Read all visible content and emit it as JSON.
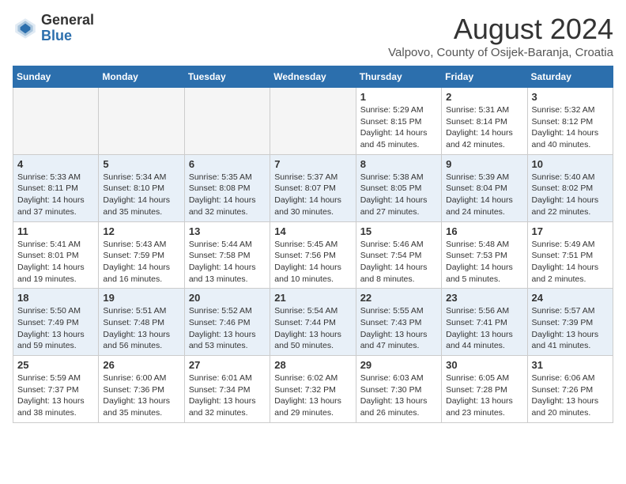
{
  "header": {
    "logo_line1": "General",
    "logo_line2": "Blue",
    "month_year": "August 2024",
    "location": "Valpovo, County of Osijek-Baranja, Croatia"
  },
  "weekdays": [
    "Sunday",
    "Monday",
    "Tuesday",
    "Wednesday",
    "Thursday",
    "Friday",
    "Saturday"
  ],
  "weeks": [
    [
      {
        "day": "",
        "info": ""
      },
      {
        "day": "",
        "info": ""
      },
      {
        "day": "",
        "info": ""
      },
      {
        "day": "",
        "info": ""
      },
      {
        "day": "1",
        "info": "Sunrise: 5:29 AM\nSunset: 8:15 PM\nDaylight: 14 hours\nand 45 minutes."
      },
      {
        "day": "2",
        "info": "Sunrise: 5:31 AM\nSunset: 8:14 PM\nDaylight: 14 hours\nand 42 minutes."
      },
      {
        "day": "3",
        "info": "Sunrise: 5:32 AM\nSunset: 8:12 PM\nDaylight: 14 hours\nand 40 minutes."
      }
    ],
    [
      {
        "day": "4",
        "info": "Sunrise: 5:33 AM\nSunset: 8:11 PM\nDaylight: 14 hours\nand 37 minutes."
      },
      {
        "day": "5",
        "info": "Sunrise: 5:34 AM\nSunset: 8:10 PM\nDaylight: 14 hours\nand 35 minutes."
      },
      {
        "day": "6",
        "info": "Sunrise: 5:35 AM\nSunset: 8:08 PM\nDaylight: 14 hours\nand 32 minutes."
      },
      {
        "day": "7",
        "info": "Sunrise: 5:37 AM\nSunset: 8:07 PM\nDaylight: 14 hours\nand 30 minutes."
      },
      {
        "day": "8",
        "info": "Sunrise: 5:38 AM\nSunset: 8:05 PM\nDaylight: 14 hours\nand 27 minutes."
      },
      {
        "day": "9",
        "info": "Sunrise: 5:39 AM\nSunset: 8:04 PM\nDaylight: 14 hours\nand 24 minutes."
      },
      {
        "day": "10",
        "info": "Sunrise: 5:40 AM\nSunset: 8:02 PM\nDaylight: 14 hours\nand 22 minutes."
      }
    ],
    [
      {
        "day": "11",
        "info": "Sunrise: 5:41 AM\nSunset: 8:01 PM\nDaylight: 14 hours\nand 19 minutes."
      },
      {
        "day": "12",
        "info": "Sunrise: 5:43 AM\nSunset: 7:59 PM\nDaylight: 14 hours\nand 16 minutes."
      },
      {
        "day": "13",
        "info": "Sunrise: 5:44 AM\nSunset: 7:58 PM\nDaylight: 14 hours\nand 13 minutes."
      },
      {
        "day": "14",
        "info": "Sunrise: 5:45 AM\nSunset: 7:56 PM\nDaylight: 14 hours\nand 10 minutes."
      },
      {
        "day": "15",
        "info": "Sunrise: 5:46 AM\nSunset: 7:54 PM\nDaylight: 14 hours\nand 8 minutes."
      },
      {
        "day": "16",
        "info": "Sunrise: 5:48 AM\nSunset: 7:53 PM\nDaylight: 14 hours\nand 5 minutes."
      },
      {
        "day": "17",
        "info": "Sunrise: 5:49 AM\nSunset: 7:51 PM\nDaylight: 14 hours\nand 2 minutes."
      }
    ],
    [
      {
        "day": "18",
        "info": "Sunrise: 5:50 AM\nSunset: 7:49 PM\nDaylight: 13 hours\nand 59 minutes."
      },
      {
        "day": "19",
        "info": "Sunrise: 5:51 AM\nSunset: 7:48 PM\nDaylight: 13 hours\nand 56 minutes."
      },
      {
        "day": "20",
        "info": "Sunrise: 5:52 AM\nSunset: 7:46 PM\nDaylight: 13 hours\nand 53 minutes."
      },
      {
        "day": "21",
        "info": "Sunrise: 5:54 AM\nSunset: 7:44 PM\nDaylight: 13 hours\nand 50 minutes."
      },
      {
        "day": "22",
        "info": "Sunrise: 5:55 AM\nSunset: 7:43 PM\nDaylight: 13 hours\nand 47 minutes."
      },
      {
        "day": "23",
        "info": "Sunrise: 5:56 AM\nSunset: 7:41 PM\nDaylight: 13 hours\nand 44 minutes."
      },
      {
        "day": "24",
        "info": "Sunrise: 5:57 AM\nSunset: 7:39 PM\nDaylight: 13 hours\nand 41 minutes."
      }
    ],
    [
      {
        "day": "25",
        "info": "Sunrise: 5:59 AM\nSunset: 7:37 PM\nDaylight: 13 hours\nand 38 minutes."
      },
      {
        "day": "26",
        "info": "Sunrise: 6:00 AM\nSunset: 7:36 PM\nDaylight: 13 hours\nand 35 minutes."
      },
      {
        "day": "27",
        "info": "Sunrise: 6:01 AM\nSunset: 7:34 PM\nDaylight: 13 hours\nand 32 minutes."
      },
      {
        "day": "28",
        "info": "Sunrise: 6:02 AM\nSunset: 7:32 PM\nDaylight: 13 hours\nand 29 minutes."
      },
      {
        "day": "29",
        "info": "Sunrise: 6:03 AM\nSunset: 7:30 PM\nDaylight: 13 hours\nand 26 minutes."
      },
      {
        "day": "30",
        "info": "Sunrise: 6:05 AM\nSunset: 7:28 PM\nDaylight: 13 hours\nand 23 minutes."
      },
      {
        "day": "31",
        "info": "Sunrise: 6:06 AM\nSunset: 7:26 PM\nDaylight: 13 hours\nand 20 minutes."
      }
    ]
  ]
}
